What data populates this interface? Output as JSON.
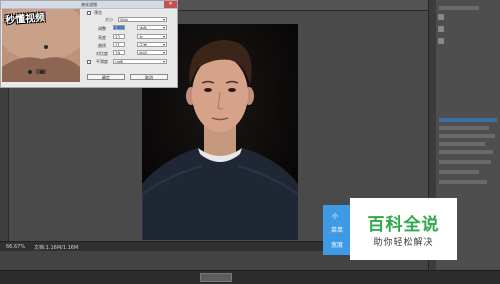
{
  "dialog": {
    "title": "液化滤镜",
    "close_icon": "close-icon",
    "labels": [
      "预览",
      "大小",
      "调整",
      "亮度",
      "曲线",
      "对比度",
      "平滑度"
    ],
    "fields": [
      "居中",
      "1",
      "12",
      "11",
      "19",
      "浅色",
      "左",
      "正常",
      "中间",
      "边缘"
    ],
    "ok_label": "确定",
    "cancel_label": "取消"
  },
  "watermark": {
    "logo_text": "秒懂视频"
  },
  "statusbar": {
    "zoom": "66.67%",
    "doc_info": "文档:1.16M/1.16M"
  },
  "overlay": {
    "lines": [
      "小",
      "菜单",
      "宽度"
    ]
  },
  "badge": {
    "title": "百科全说",
    "subtitle": "助你轻松解决"
  },
  "colors": {
    "accent_blue": "#3f9ae6",
    "badge_green": "#30a84c",
    "workspace": "#4a4a4a"
  }
}
